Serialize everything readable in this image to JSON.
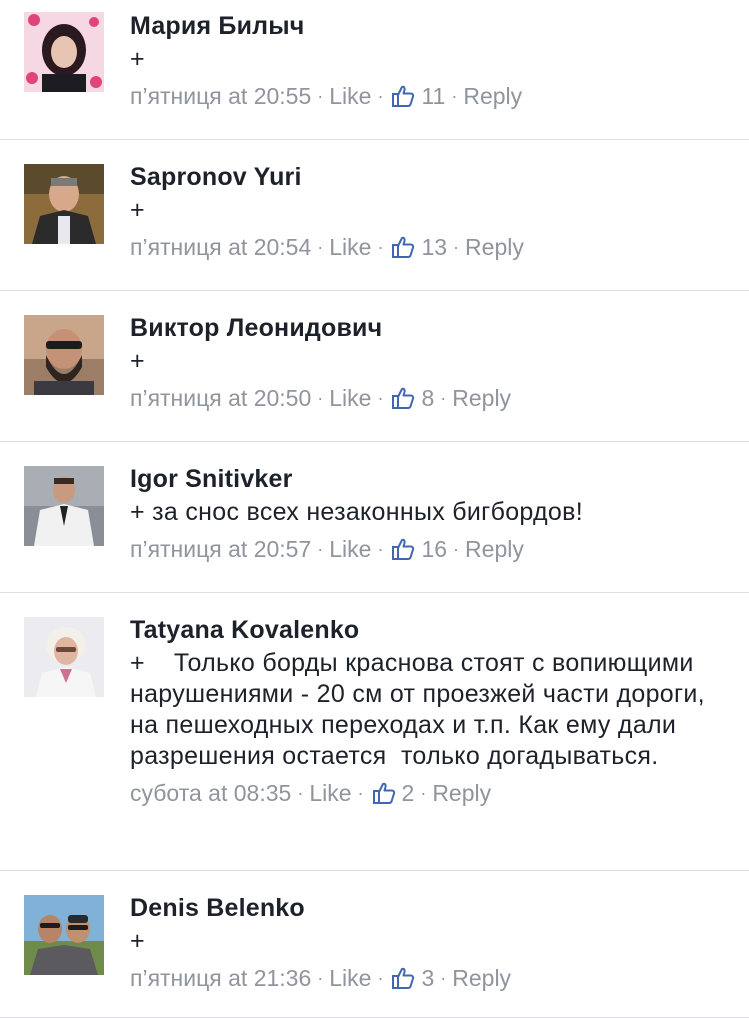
{
  "colors": {
    "author": "#1d2129",
    "meta": "#90949c",
    "like_icon": "#4267b2",
    "divider": "#dcdee3"
  },
  "comments": [
    {
      "author": "Мария Билыч",
      "text": "+",
      "time": "п’ятниця at 20:55",
      "like_label": "Like",
      "like_count": "11",
      "reply_label": "Reply"
    },
    {
      "author": "Sapronov Yuri",
      "text": "+",
      "time": "п’ятниця at 20:54",
      "like_label": "Like",
      "like_count": "13",
      "reply_label": "Reply"
    },
    {
      "author": "Виктор Леонидович",
      "text": "+",
      "time": "п’ятниця at 20:50",
      "like_label": "Like",
      "like_count": "8",
      "reply_label": "Reply"
    },
    {
      "author": "Igor Snitivker",
      "text": "+ за снос всех незаконных бигбордов!",
      "time": "п’ятниця at 20:57",
      "like_label": "Like",
      "like_count": "16",
      "reply_label": "Reply"
    },
    {
      "author": "Tatyana  Kovalenko",
      "text": "+    Только борды краснова стоят с вопиющими нарушениями - 20 см от проезжей части дороги, на пешеходных переходах и т.п. Как ему дали разрешения остается  только догадываться.",
      "time": "субота at 08:35",
      "like_label": "Like",
      "like_count": "2",
      "reply_label": "Reply"
    },
    {
      "author": "Denis Belenko",
      "text": "+",
      "time": "п’ятниця at 21:36",
      "like_label": "Like",
      "like_count": "3",
      "reply_label": "Reply"
    }
  ]
}
